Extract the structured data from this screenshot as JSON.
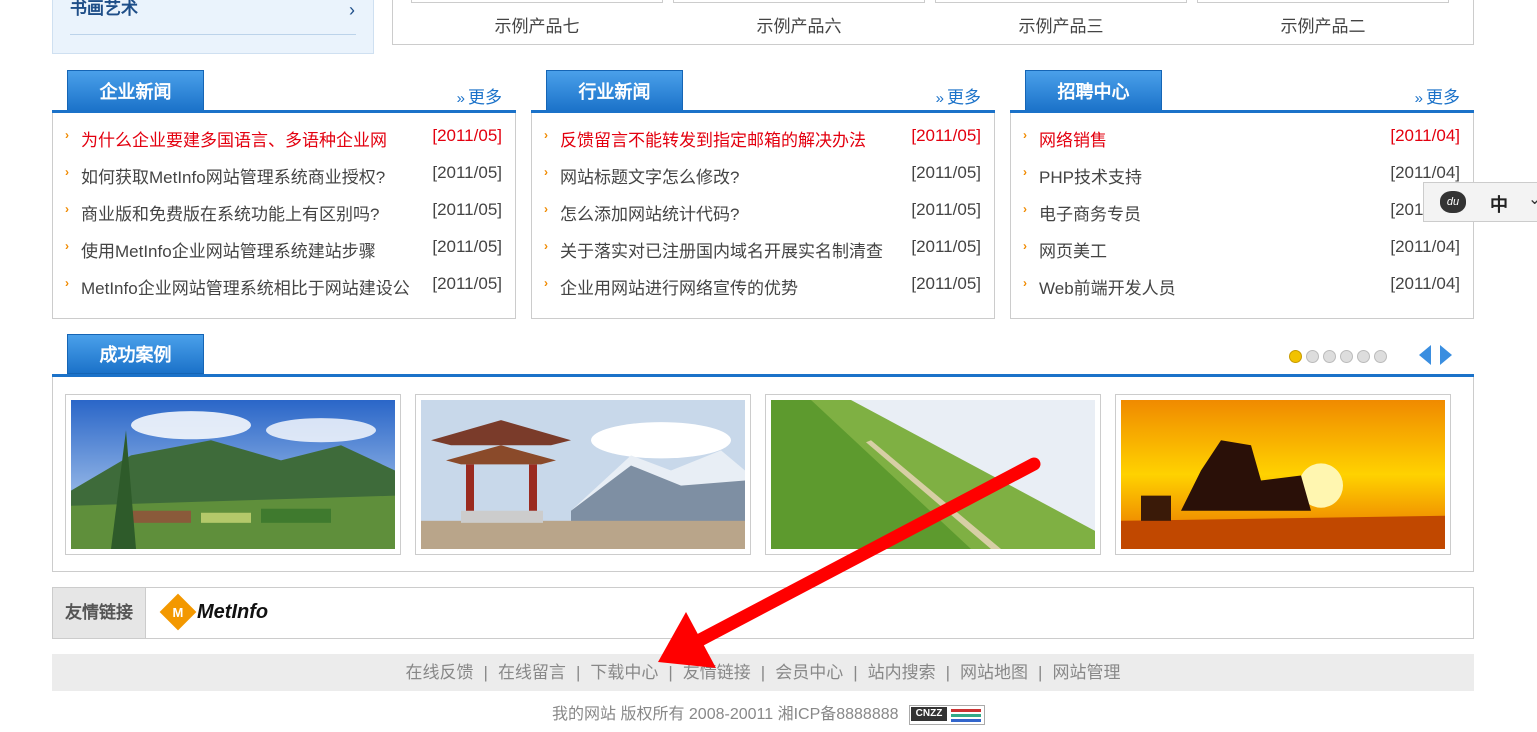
{
  "sidebar_fragment": {
    "label": "书画艺术",
    "chevron": "›"
  },
  "products": [
    {
      "caption": "示例产品七"
    },
    {
      "caption": "示例产品六"
    },
    {
      "caption": "示例产品三"
    },
    {
      "caption": "示例产品二"
    }
  ],
  "more_label": "更多",
  "more_glyph": "»",
  "news_boxes": [
    {
      "title": "企业新闻",
      "items": [
        {
          "title": "为什么企业要建多国语言、多语种企业网",
          "date": "[2011/05]",
          "hot": true
        },
        {
          "title": "如何获取MetInfo网站管理系统商业授权?",
          "date": "[2011/05]"
        },
        {
          "title": "商业版和免费版在系统功能上有区别吗?",
          "date": "[2011/05]"
        },
        {
          "title": "使用MetInfo企业网站管理系统建站步骤",
          "date": "[2011/05]"
        },
        {
          "title": "MetInfo企业网站管理系统相比于网站建设公",
          "date": "[2011/05]"
        }
      ]
    },
    {
      "title": "行业新闻",
      "items": [
        {
          "title": "反馈留言不能转发到指定邮箱的解决办法",
          "date": "[2011/05]",
          "hot": true
        },
        {
          "title": "网站标题文字怎么修改?",
          "date": "[2011/05]"
        },
        {
          "title": "怎么添加网站统计代码?",
          "date": "[2011/05]"
        },
        {
          "title": "关于落实对已注册国内域名开展实名制清查",
          "date": "[2011/05]"
        },
        {
          "title": "企业用网站进行网络宣传的优势",
          "date": "[2011/05]"
        }
      ]
    },
    {
      "title": "招聘中心",
      "items": [
        {
          "title": "网络销售",
          "date": "[2011/04]",
          "hot": true
        },
        {
          "title": "PHP技术支持",
          "date": "[2011/04]"
        },
        {
          "title": "电子商务专员",
          "date": "[2011/04]"
        },
        {
          "title": "网页美工",
          "date": "[2011/04]"
        },
        {
          "title": "Web前端开发人员",
          "date": "[2011/04]"
        }
      ]
    }
  ],
  "cases": {
    "title": "成功案例",
    "pager_count": 6,
    "pager_active": 0,
    "images": [
      "landscape-valley",
      "pavilion-mountain",
      "grass-hill-path",
      "sunset-sea-rocks"
    ]
  },
  "friend_links": {
    "label": "友情链接",
    "logo_text": "MetInfo",
    "logo_mark": "M"
  },
  "footer_nav": [
    "在线反馈",
    "在线留言",
    "下载中心",
    "友情链接",
    "会员中心",
    "站内搜索",
    "网站地图",
    "网站管理"
  ],
  "copyright": "我的网站 版权所有 2008-20011 湘ICP备8888888",
  "cnzz_badge": "CNZZ",
  "baidu_widget": {
    "icon": "du",
    "lang": "中",
    "caret": "⌄"
  },
  "colors": {
    "accent_blue": "#1b72c9",
    "hot_red": "#e3000f",
    "bullet_orange": "#f08a00",
    "annotation_red": "#ff0000"
  }
}
